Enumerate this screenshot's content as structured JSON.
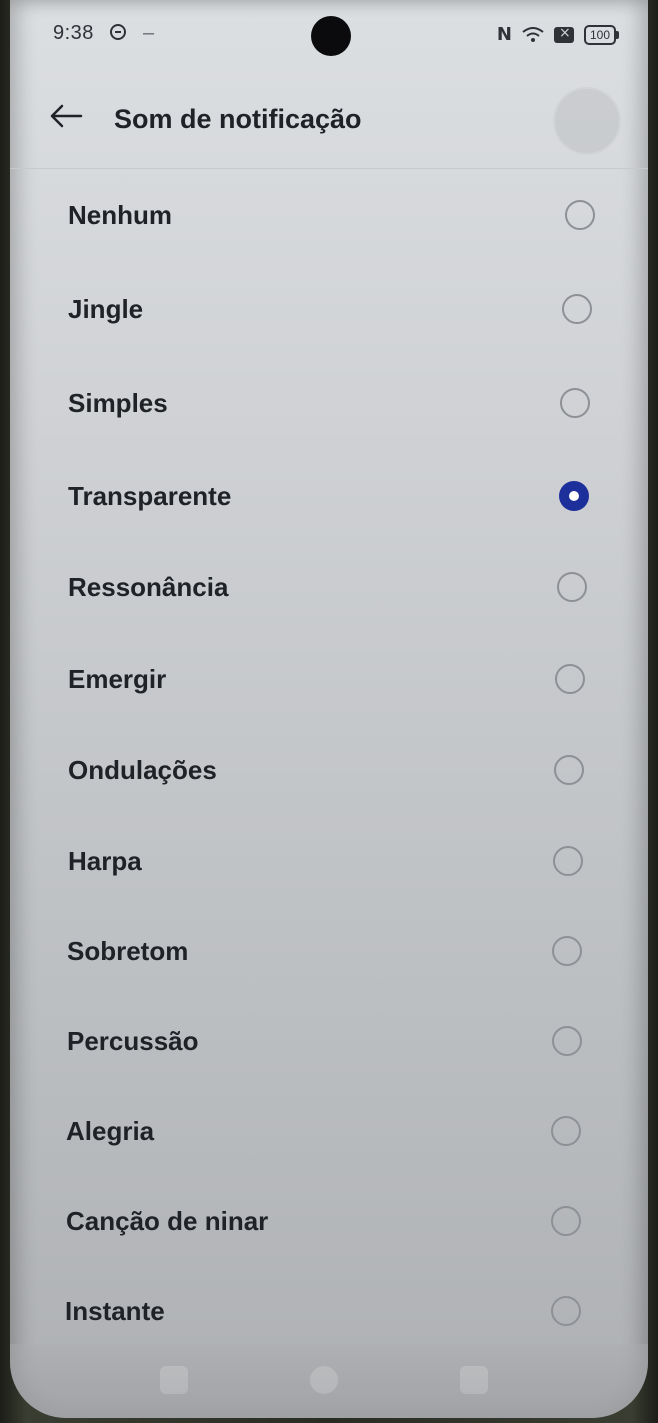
{
  "status_bar": {
    "time": "9:38",
    "separator": "–",
    "nfc_icon": "N",
    "battery": "100"
  },
  "header": {
    "back_icon": "arrow-left-icon",
    "title": "Som de notificação"
  },
  "options": [
    {
      "label": "Nenhum",
      "selected": false
    },
    {
      "label": "Jingle",
      "selected": false
    },
    {
      "label": "Simples",
      "selected": false
    },
    {
      "label": "Transparente",
      "selected": true
    },
    {
      "label": "Ressonância",
      "selected": false
    },
    {
      "label": "Emergir",
      "selected": false
    },
    {
      "label": "Ondulações",
      "selected": false
    },
    {
      "label": "Harpa",
      "selected": false
    },
    {
      "label": "Sobretom",
      "selected": false
    },
    {
      "label": "Percussão",
      "selected": false
    },
    {
      "label": "Alegria",
      "selected": false
    },
    {
      "label": "Canção de ninar",
      "selected": false
    },
    {
      "label": "Instante",
      "selected": false
    }
  ],
  "colors": {
    "accent": "#1c2f9a",
    "text": "#1f2226"
  }
}
